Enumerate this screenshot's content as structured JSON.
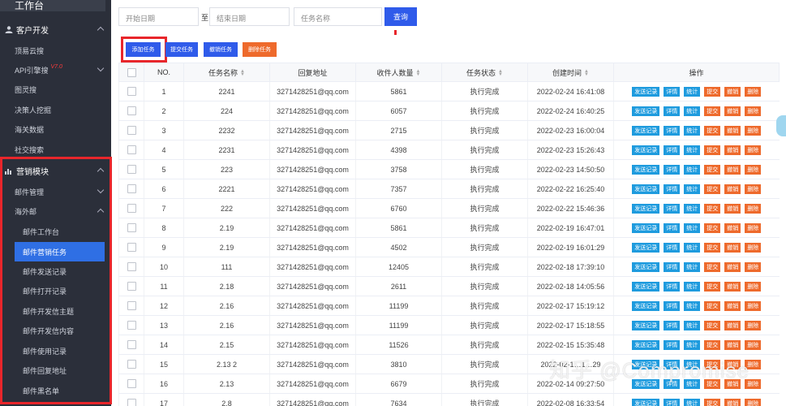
{
  "sidebar": {
    "top_label": "工作台",
    "sections": [
      {
        "label": "客户开发",
        "expanded": true
      },
      {
        "label": "营销模块",
        "expanded": true
      }
    ],
    "dev_items": [
      {
        "label": "顶易云搜"
      },
      {
        "label": "API引擎搜",
        "tag": "V7.0"
      },
      {
        "label": "图灵搜"
      },
      {
        "label": "决策人挖掘"
      },
      {
        "label": "海关数据"
      },
      {
        "label": "社交搜索"
      }
    ],
    "marketing_items": [
      {
        "label": "邮件管理"
      },
      {
        "label": "海外邮"
      }
    ],
    "mail_items": [
      {
        "label": "邮件工作台"
      },
      {
        "label": "邮件营销任务",
        "active": true
      },
      {
        "label": "邮件发送记录"
      },
      {
        "label": "邮件打开记录"
      },
      {
        "label": "邮件开发信主题"
      },
      {
        "label": "邮件开发信内容"
      },
      {
        "label": "邮件使用记录"
      },
      {
        "label": "邮件回复地址"
      },
      {
        "label": "邮件黑名单"
      }
    ]
  },
  "filters": {
    "start_date_placeholder": "开始日期",
    "to_label": "至",
    "end_date_placeholder": "结束日期",
    "task_name_placeholder": "任务名称",
    "query_label": "查询"
  },
  "actions": {
    "add": "添加任务",
    "submit": "提交任务",
    "revoke": "撤销任务",
    "delete": "删除任务"
  },
  "colors": {
    "sidebar_bg": "#2b2f3a",
    "primary": "#2f5bea",
    "info": "#1e9bde",
    "warn": "#ee6a2c",
    "highlight": "#e8262b"
  },
  "table": {
    "headers": {
      "no": "NO.",
      "name": "任务名称",
      "reply": "回复地址",
      "count": "收件人数量",
      "status": "任务状态",
      "created": "创建时间",
      "ops": "操作"
    },
    "op_labels": {
      "send_log": "发送记录",
      "detail": "详情",
      "stats": "统计",
      "submit": "提交",
      "revoke": "撤销",
      "delete": "删除"
    },
    "rows": [
      {
        "no": "1",
        "name": "2241",
        "reply": "3271428251@qq.com",
        "count": "5861",
        "status": "执行完成",
        "created": "2022-02-24 16:41:08"
      },
      {
        "no": "2",
        "name": "224",
        "reply": "3271428251@qq.com",
        "count": "6057",
        "status": "执行完成",
        "created": "2022-02-24 16:40:25"
      },
      {
        "no": "3",
        "name": "2232",
        "reply": "3271428251@qq.com",
        "count": "2715",
        "status": "执行完成",
        "created": "2022-02-23 16:00:04"
      },
      {
        "no": "4",
        "name": "2231",
        "reply": "3271428251@qq.com",
        "count": "4398",
        "status": "执行完成",
        "created": "2022-02-23 15:26:43"
      },
      {
        "no": "5",
        "name": "223",
        "reply": "3271428251@qq.com",
        "count": "3758",
        "status": "执行完成",
        "created": "2022-02-23 14:50:50"
      },
      {
        "no": "6",
        "name": "2221",
        "reply": "3271428251@qq.com",
        "count": "7357",
        "status": "执行完成",
        "created": "2022-02-22 16:25:40"
      },
      {
        "no": "7",
        "name": "222",
        "reply": "3271428251@qq.com",
        "count": "6760",
        "status": "执行完成",
        "created": "2022-02-22 15:46:36"
      },
      {
        "no": "8",
        "name": "2.19",
        "reply": "3271428251@qq.com",
        "count": "5861",
        "status": "执行完成",
        "created": "2022-02-19 16:47:01"
      },
      {
        "no": "9",
        "name": "2.19",
        "reply": "3271428251@qq.com",
        "count": "4502",
        "status": "执行完成",
        "created": "2022-02-19 16:01:29"
      },
      {
        "no": "10",
        "name": "111",
        "reply": "3271428251@qq.com",
        "count": "12405",
        "status": "执行完成",
        "created": "2022-02-18 17:39:10"
      },
      {
        "no": "11",
        "name": "2.18",
        "reply": "3271428251@qq.com",
        "count": "2611",
        "status": "执行完成",
        "created": "2022-02-18 14:05:56"
      },
      {
        "no": "12",
        "name": "2.16",
        "reply": "3271428251@qq.com",
        "count": "11199",
        "status": "执行完成",
        "created": "2022-02-17 15:19:12"
      },
      {
        "no": "13",
        "name": "2.16",
        "reply": "3271428251@qq.com",
        "count": "11199",
        "status": "执行完成",
        "created": "2022-02-17 15:18:55"
      },
      {
        "no": "14",
        "name": "2.15",
        "reply": "3271428251@qq.com",
        "count": "11526",
        "status": "执行完成",
        "created": "2022-02-15 15:35:48"
      },
      {
        "no": "15",
        "name": "2.13 2",
        "reply": "3271428251@qq.com",
        "count": "3810",
        "status": "执行完成",
        "created": "2022-02-1…1…29"
      },
      {
        "no": "16",
        "name": "2.13",
        "reply": "3271428251@qq.com",
        "count": "6679",
        "status": "执行完成",
        "created": "2022-02-14 09:27:50"
      },
      {
        "no": "17",
        "name": "2.8",
        "reply": "3271428251@qq.com",
        "count": "7634",
        "status": "执行完成",
        "created": "2022-02-08 16:33:54"
      }
    ]
  },
  "watermark": "知乎 @Compromise"
}
